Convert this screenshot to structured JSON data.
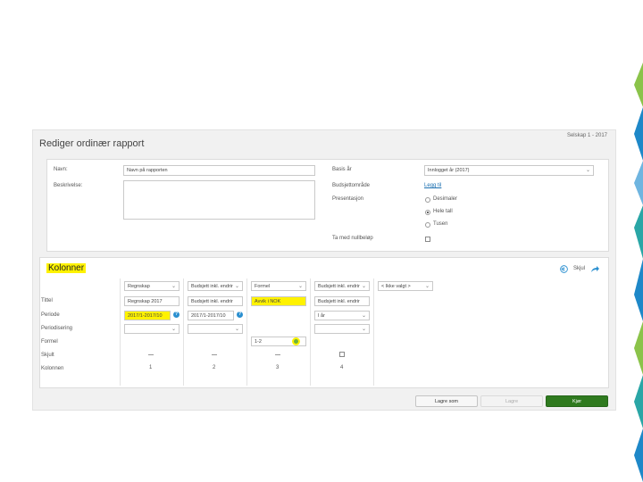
{
  "window": {
    "title": "Rediger ordinær rapport",
    "company": "Selskap 1 - 2017"
  },
  "form": {
    "name_label": "Navn:",
    "name_value": "Navn på rapporten",
    "description_label": "Beskrivelse:",
    "basis_label": "Basis år",
    "basis_value": "Innlogget år (2017)",
    "budget_label": "Budsjettområde",
    "budget_link": "Legg til",
    "presentation_label": "Presentasjon",
    "presentation_options": [
      "Desimaler",
      "Hele tall",
      "Tusen"
    ],
    "presentation_selected": "Hele tall",
    "zero_label": "Ta med nullbeløp"
  },
  "columns_section": {
    "heading": "Kolonner",
    "hide_label": "Skjul",
    "row_labels": [
      "Tittel",
      "Periode",
      "Periodisering",
      "Formel",
      "Skjult",
      "Kolonnen"
    ],
    "columns": [
      {
        "type": "Regnskap",
        "title": "Regnskap 2017",
        "period": "2017/1-2017/10",
        "number": "1"
      },
      {
        "type": "Budsjett inkl. endrir",
        "title": "Budsjett inkl. endrir",
        "period": "2017/1-2017/10",
        "number": "2"
      },
      {
        "type": "Formel",
        "title": "Avvik i NOK",
        "formula": "1-2",
        "number": "3"
      },
      {
        "type": "Budsjett inkl. endrir",
        "title": "Budsjett inkl. endrir",
        "period_select": "I år",
        "number": "4"
      }
    ],
    "add_column": "< Ikke valgt >"
  },
  "buttons": {
    "save_as": "Lagre som",
    "save": "Lagre",
    "run": "Kjør"
  },
  "colors": {
    "highlight": "#fff200",
    "accent": "#2a8fd0",
    "primary_button": "#2f7a1f"
  }
}
